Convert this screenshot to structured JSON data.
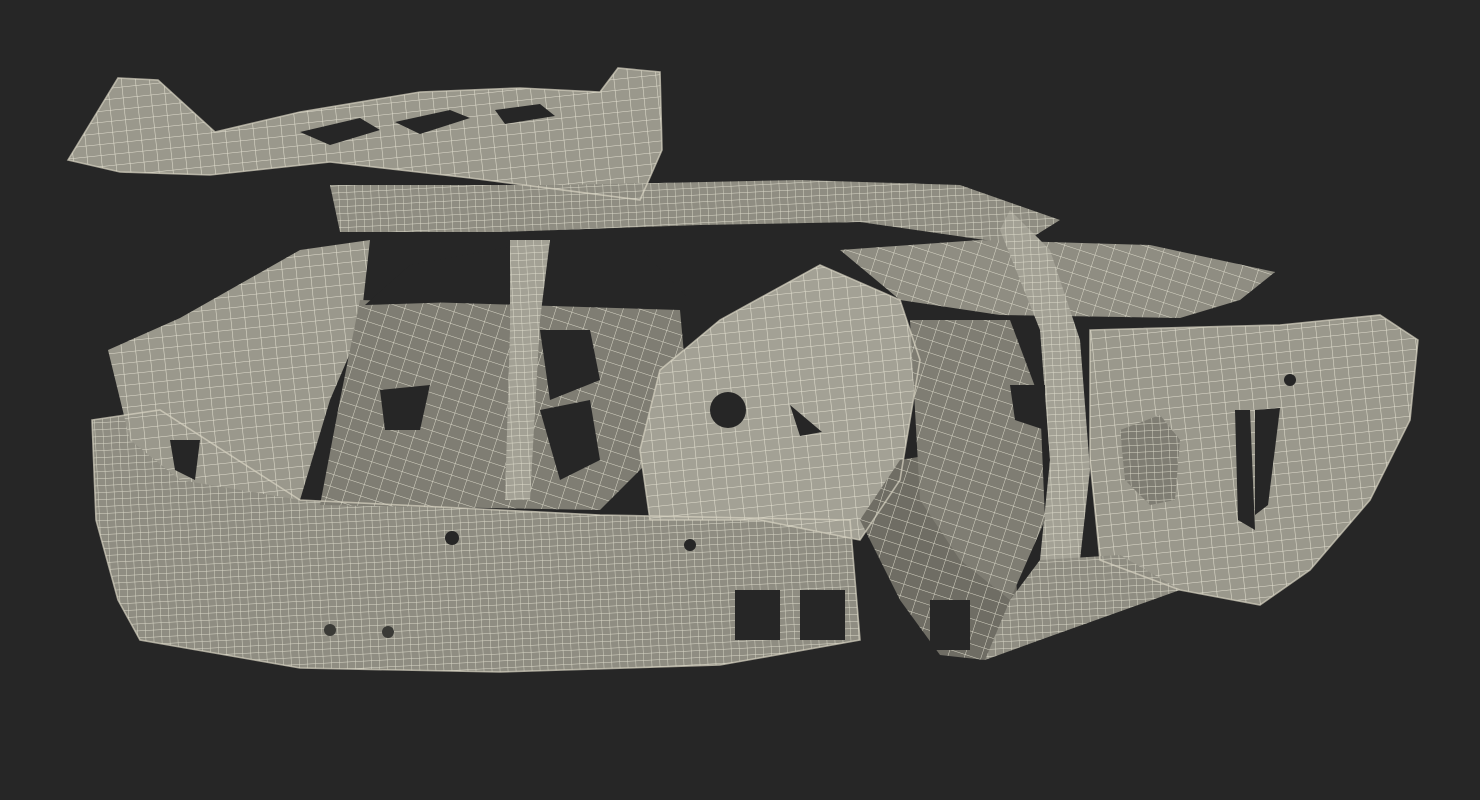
{
  "scene": {
    "subject": "car-body-wireframe",
    "colors": {
      "background": "#262626",
      "panel": "#8f8d82",
      "panel_light": "#a3a195",
      "panel_dark": "#6f6d64",
      "wire": "#e9e6d6",
      "hole": "#262626"
    }
  }
}
